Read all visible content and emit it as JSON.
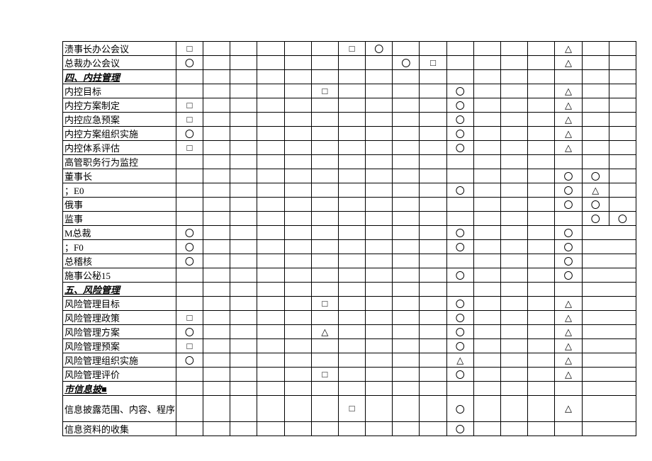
{
  "rows": [
    {
      "label": "渍事长办公会议",
      "cells": [
        "□",
        "",
        "",
        "",
        "",
        "",
        "□",
        "〇",
        "",
        "",
        "",
        "",
        "",
        "",
        "△",
        "",
        ""
      ]
    },
    {
      "label": "总裁办公会议",
      "cells": [
        "〇",
        "",
        "",
        "",
        "",
        "",
        "",
        "",
        "〇",
        "□",
        "",
        "",
        "",
        "",
        "△",
        "",
        ""
      ]
    },
    {
      "label": "四、内拄管理",
      "section": true,
      "cells": [
        "",
        "",
        "",
        "",
        "",
        "",
        "",
        "",
        "",
        "",
        "",
        "",
        "",
        "",
        "",
        "",
        ""
      ]
    },
    {
      "label": "内控目标",
      "cells": [
        "",
        "",
        "",
        "",
        "",
        "□",
        "",
        "",
        "",
        "",
        "〇",
        "",
        "",
        "",
        "△",
        "",
        ""
      ]
    },
    {
      "label": "内控方案制定",
      "cells": [
        "□",
        "",
        "",
        "",
        "",
        "",
        "",
        "",
        "",
        "",
        "〇",
        "",
        "",
        "",
        "△",
        "",
        ""
      ]
    },
    {
      "label": "内控应急预案",
      "cells": [
        "□",
        "",
        "",
        "",
        "",
        "",
        "",
        "",
        "",
        "",
        "〇",
        "",
        "",
        "",
        "△",
        "",
        ""
      ]
    },
    {
      "label": "内控方案组织实施",
      "cells": [
        "〇",
        "",
        "",
        "",
        "",
        "",
        "",
        "",
        "",
        "",
        "〇",
        "",
        "",
        "",
        "△",
        "",
        ""
      ]
    },
    {
      "label": "内控体系评估",
      "cells": [
        "□",
        "",
        "",
        "",
        "",
        "",
        "",
        "",
        "",
        "",
        "〇",
        "",
        "",
        "",
        "△",
        "",
        ""
      ]
    },
    {
      "label": "高管职务行为监控",
      "cells": [
        "",
        "",
        "",
        "",
        "",
        "",
        "",
        "",
        "",
        "",
        "",
        "",
        "",
        "",
        "",
        "",
        ""
      ]
    },
    {
      "label": "董事长",
      "cells": [
        "",
        "",
        "",
        "",
        "",
        "",
        "",
        "",
        "",
        "",
        "",
        "",
        "",
        "",
        "〇",
        "〇",
        ""
      ]
    },
    {
      "label": "；E0",
      "cells": [
        "",
        "",
        "",
        "",
        "",
        "",
        "",
        "",
        "",
        "",
        "〇",
        "",
        "",
        "",
        "〇",
        "△",
        ""
      ]
    },
    {
      "label": "俄事",
      "cells": [
        "",
        "",
        "",
        "",
        "",
        "",
        "",
        "",
        "",
        "",
        "",
        "",
        "",
        "",
        "〇",
        "〇",
        ""
      ]
    },
    {
      "label": "监事",
      "cells": [
        "",
        "",
        "",
        "",
        "",
        "",
        "",
        "",
        "",
        "",
        "",
        "",
        "",
        "",
        "",
        "〇",
        "〇"
      ]
    },
    {
      "label": "M总裁",
      "spanlast": true,
      "cells": [
        "〇",
        "",
        "",
        "",
        "",
        "",
        "",
        "",
        "",
        "",
        "〇",
        "",
        "",
        "",
        "〇",
        "",
        ""
      ]
    },
    {
      "label": "；F0",
      "spanlast": true,
      "cells": [
        "〇",
        "",
        "",
        "",
        "",
        "",
        "",
        "",
        "",
        "",
        "〇",
        "",
        "",
        "",
        "〇",
        "",
        ""
      ]
    },
    {
      "label": "总稽核",
      "spanlast": true,
      "cells": [
        "〇",
        "",
        "",
        "",
        "",
        "",
        "",
        "",
        "",
        "",
        "",
        "",
        "",
        "",
        "〇",
        "",
        ""
      ]
    },
    {
      "label": "施事公秘15",
      "spanlast": true,
      "cells": [
        "",
        "",
        "",
        "",
        "",
        "",
        "",
        "",
        "",
        "",
        "〇",
        "",
        "",
        "",
        "〇",
        "",
        ""
      ]
    },
    {
      "label": "五、风险管理",
      "section": true,
      "spanlast": true,
      "cells": [
        "",
        "",
        "",
        "",
        "",
        "",
        "",
        "",
        "",
        "",
        "",
        "",
        "",
        "",
        "",
        "",
        ""
      ]
    },
    {
      "label": "风险管理目标",
      "spanlast": true,
      "cells": [
        "",
        "",
        "",
        "",
        "",
        "□",
        "",
        "",
        "",
        "",
        "〇",
        "",
        "",
        "",
        "△",
        "",
        ""
      ]
    },
    {
      "label": "风险管理政策",
      "spanlast": true,
      "cells": [
        "□",
        "",
        "",
        "",
        "",
        "",
        "",
        "",
        "",
        "",
        "〇",
        "",
        "",
        "",
        "△",
        "",
        ""
      ]
    },
    {
      "label": "风险管理方案",
      "spanlast": true,
      "cells": [
        "〇",
        "",
        "",
        "",
        "",
        "△",
        "",
        "",
        "",
        "",
        "〇",
        "",
        "",
        "",
        "△",
        "",
        ""
      ]
    },
    {
      "label": "风险管理预案",
      "spanlast": true,
      "cells": [
        "□",
        "",
        "",
        "",
        "",
        "",
        "",
        "",
        "",
        "",
        "〇",
        "",
        "",
        "",
        "△",
        "",
        ""
      ]
    },
    {
      "label": "风险管理组织实施",
      "spanlast": true,
      "cells": [
        "〇",
        "",
        "",
        "",
        "",
        "",
        "",
        "",
        "",
        "",
        "△",
        "",
        "",
        "",
        "△",
        "",
        ""
      ]
    },
    {
      "label": "风险管理评价",
      "spanlast": true,
      "cells": [
        "",
        "",
        "",
        "",
        "",
        "□",
        "",
        "",
        "",
        "",
        "〇",
        "",
        "",
        "",
        "△",
        "",
        ""
      ]
    },
    {
      "label": "市信息披■",
      "section": true,
      "spanlast": true,
      "cells": [
        "",
        "",
        "",
        "",
        "",
        "",
        "",
        "",
        "",
        "",
        "",
        "",
        "",
        "",
        "",
        "",
        ""
      ]
    },
    {
      "label": "信息披露范围、内容、程序",
      "spanlast": true,
      "tall": true,
      "cells": [
        "",
        "",
        "",
        "",
        "",
        "",
        "□",
        "",
        "",
        "",
        "〇",
        "",
        "",
        "",
        "△",
        "",
        ""
      ]
    },
    {
      "label": "信息资料的收集",
      "spanlast": true,
      "cells": [
        "",
        "",
        "",
        "",
        "",
        "",
        "",
        "",
        "",
        "",
        "〇",
        "",
        "",
        "",
        "",
        "",
        ""
      ]
    }
  ]
}
